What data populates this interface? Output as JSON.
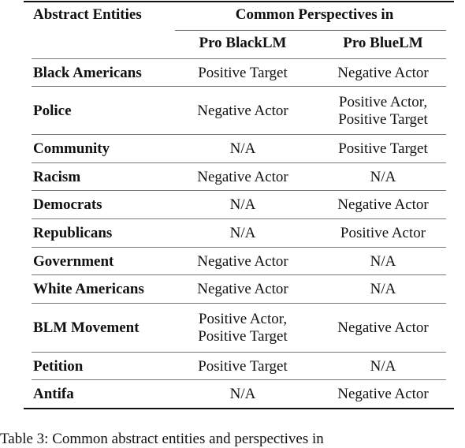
{
  "table": {
    "header": {
      "entity_col": "Abstract Entities",
      "group_label": "Common Perspectives in",
      "col_black": "Pro BlackLM",
      "col_blue": "Pro BlueLM"
    },
    "rows": [
      {
        "entity": "Black Americans",
        "black": [
          "Positive Target"
        ],
        "blue": [
          "Negative Actor"
        ]
      },
      {
        "entity": "Police",
        "black": [
          "Negative Actor"
        ],
        "blue": [
          "Positive Actor,",
          "Positive Target"
        ]
      },
      {
        "entity": "Community",
        "black": [
          "N/A"
        ],
        "blue": [
          "Positive Target"
        ]
      },
      {
        "entity": "Racism",
        "black": [
          "Negative Actor"
        ],
        "blue": [
          "N/A"
        ]
      },
      {
        "entity": "Democrats",
        "black": [
          "N/A"
        ],
        "blue": [
          "Negative Actor"
        ]
      },
      {
        "entity": "Republicans",
        "black": [
          "N/A"
        ],
        "blue": [
          "Positive Actor"
        ]
      },
      {
        "entity": "Government",
        "black": [
          "Negative Actor"
        ],
        "blue": [
          "N/A"
        ]
      },
      {
        "entity": "White Americans",
        "black": [
          "Negative Actor"
        ],
        "blue": [
          "N/A"
        ]
      },
      {
        "entity": "BLM Movement",
        "black": [
          "Positive Actor,",
          "Positive Target"
        ],
        "blue": [
          "Negative Actor"
        ]
      },
      {
        "entity": "Petition",
        "black": [
          "Positive Target"
        ],
        "blue": [
          "N/A"
        ]
      },
      {
        "entity": "Antifa",
        "black": [
          "N/A"
        ],
        "blue": [
          "Negative Actor"
        ]
      }
    ]
  },
  "caption": "Table 3: Common abstract entities and perspectives in"
}
